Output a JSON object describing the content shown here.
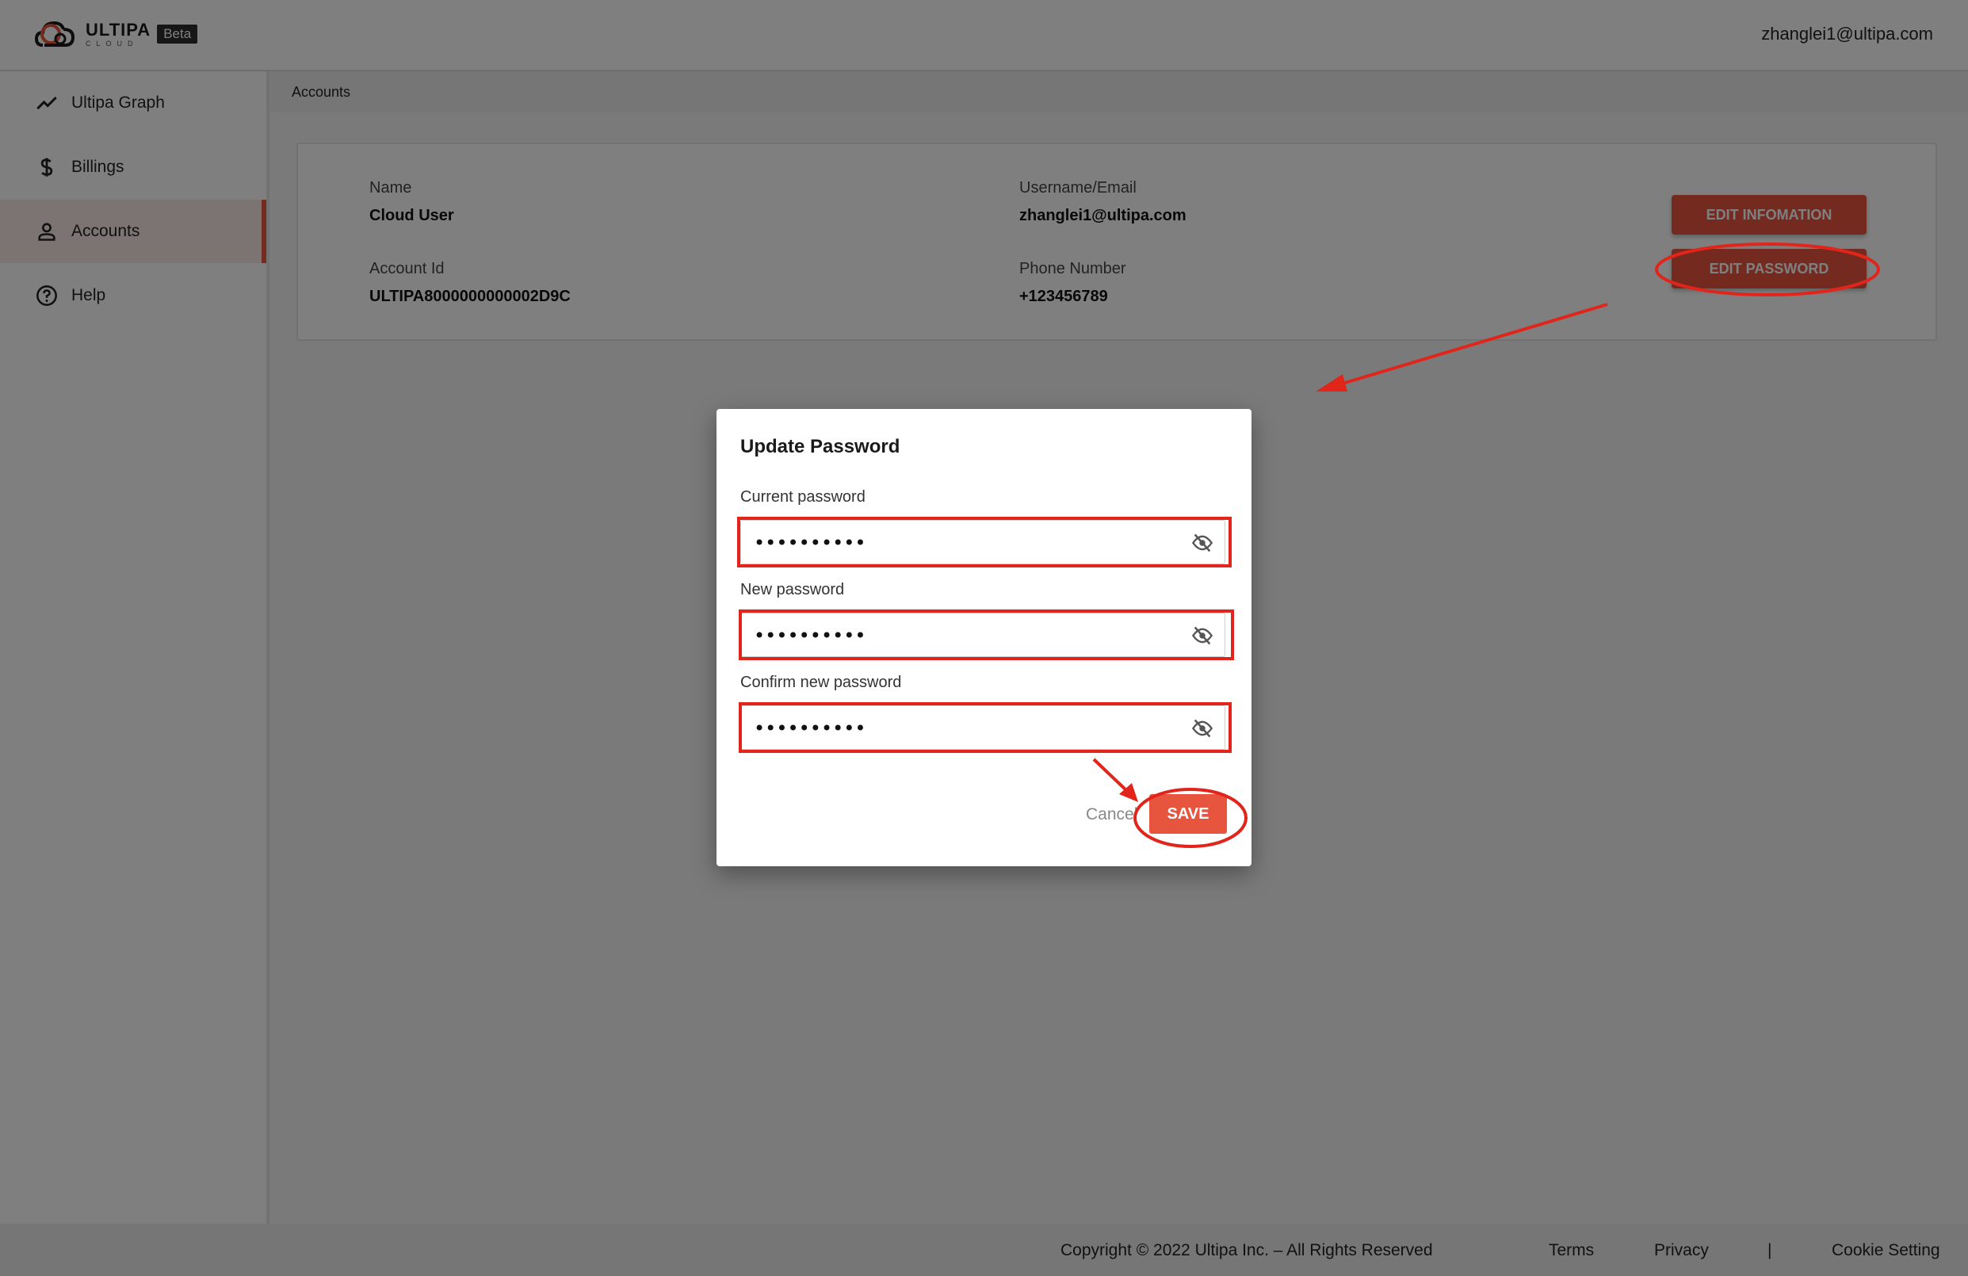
{
  "header": {
    "logo_word": "ULTIPA",
    "logo_sub": "CLOUD",
    "beta_badge": "Beta",
    "user_email": "zhanglei1@ultipa.com"
  },
  "sidebar": {
    "items": [
      {
        "label": "Ultipa Graph",
        "icon": "trending-up-icon"
      },
      {
        "label": "Billings",
        "icon": "dollar-icon"
      },
      {
        "label": "Accounts",
        "icon": "person-icon",
        "active": true
      },
      {
        "label": "Help",
        "icon": "help-circle-icon"
      }
    ]
  },
  "breadcrumb": "Accounts",
  "account": {
    "name_label": "Name",
    "name_value": "Cloud User",
    "email_label": "Username/Email",
    "email_value": "zhanglei1@ultipa.com",
    "id_label": "Account Id",
    "id_value": "ULTIPA8000000000002D9C",
    "phone_label": "Phone Number",
    "phone_value": "+123456789",
    "edit_info_button": "EDIT INFOMATION",
    "edit_password_button": "EDIT PASSWORD"
  },
  "dialog": {
    "title": "Update Password",
    "current_label": "Current password",
    "current_value": "••••••••••",
    "new_label": "New password",
    "new_value": "••••••••••",
    "confirm_label": "Confirm new password",
    "confirm_value": "••••••••••",
    "cancel_button": "Cancel",
    "save_button": "SAVE"
  },
  "footer": {
    "copyright": "Copyright © 2022 Ultipa Inc. – All Rights Reserved",
    "terms": "Terms",
    "privacy": "Privacy",
    "separator": "|",
    "cookie": "Cookie Setting"
  },
  "colors": {
    "accent": "#e8553f",
    "annotation": "#e1251b"
  }
}
